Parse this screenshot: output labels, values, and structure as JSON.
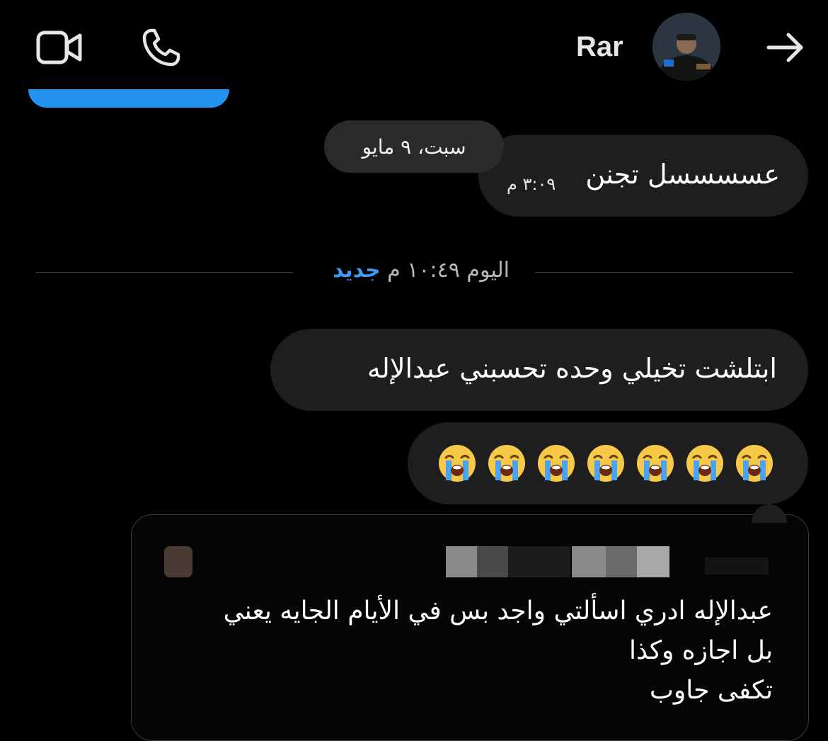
{
  "header": {
    "contact_name": "Rar",
    "icons": [
      "video-call-icon",
      "phone-icon",
      "back-arrow-icon"
    ]
  },
  "messages": [
    {
      "date_chip": "سبت، ٩ مايو",
      "text": "عسسسسل تجنن",
      "time": "٣:٠٩ م"
    }
  ],
  "new_divider": {
    "time_label": "اليوم ١٠:٤٩ م",
    "new_label": "جديد"
  },
  "new_messages": [
    {
      "text": "ابتلشت تخيلي وحده تحسبني عبدالإله"
    },
    {
      "emoji": "loudly-crying-face",
      "count": 7
    }
  ],
  "note_card": {
    "lines": [
      "عبدالإله ادري اسألتي واجد بس في الأيام الجايه يعني",
      "بل اجازه وكذا",
      "تكفى جاوب"
    ]
  },
  "colors": {
    "background": "#000000",
    "bubble": "#1e1e1f",
    "accent_blue": "#2493f0",
    "divider_new": "#3f98f2"
  }
}
